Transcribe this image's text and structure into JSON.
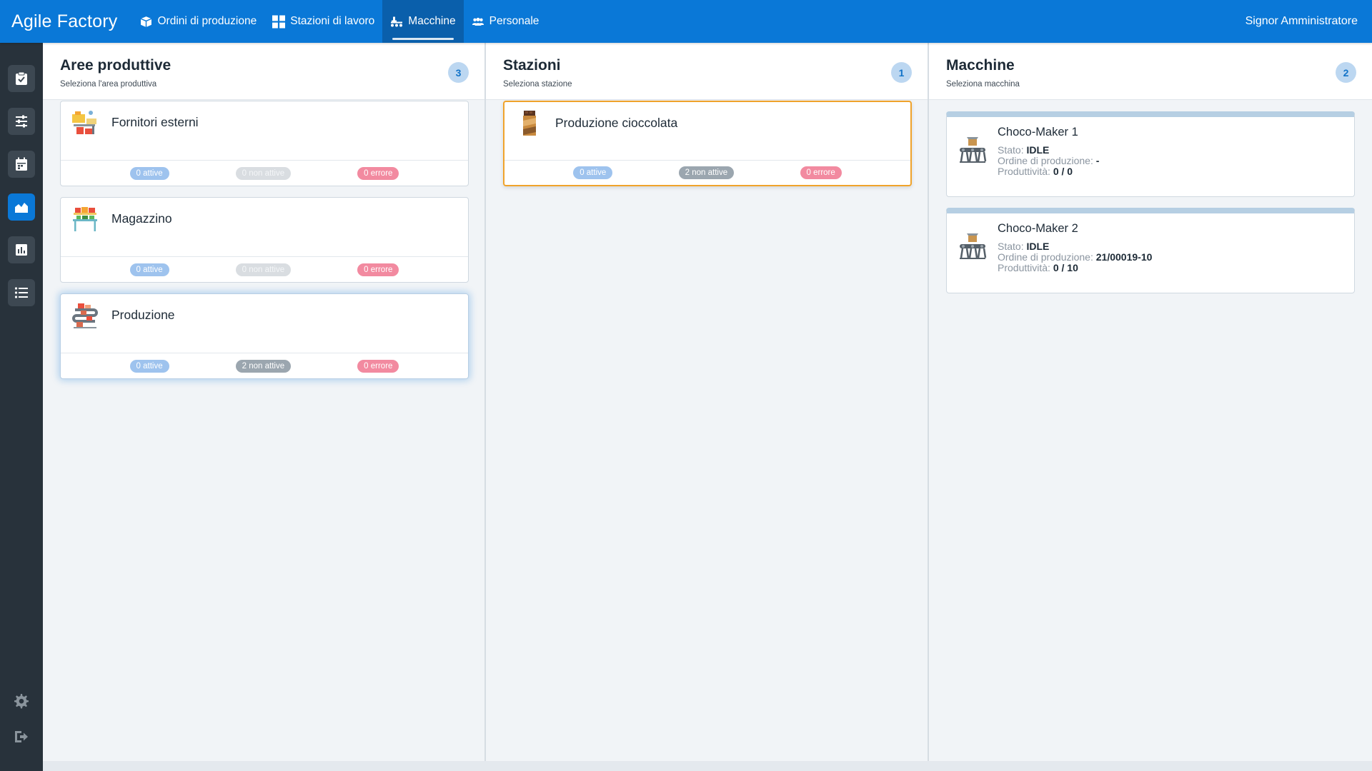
{
  "app": {
    "brand": "Agile Factory",
    "user": "Signor Amministratore"
  },
  "nav": [
    {
      "label": "Ordini di produzione",
      "icon": "box-icon"
    },
    {
      "label": "Stazioni di lavoro",
      "icon": "grid-icon"
    },
    {
      "label": "Macchine",
      "icon": "machine-icon",
      "active": true
    },
    {
      "label": "Personale",
      "icon": "people-icon"
    }
  ],
  "sidebar": {
    "items": [
      "clipboard-check-icon",
      "sliders-icon",
      "calendar-icon",
      "factory-chart-icon",
      "bar-chart-icon",
      "list-icon"
    ],
    "active_index": 3,
    "bottom": [
      "gear-icon",
      "logout-icon"
    ]
  },
  "columns": {
    "areas": {
      "title": "Aree produttive",
      "subtitle": "Seleziona l'area produttiva",
      "count": "3",
      "cards": [
        {
          "name": "Fornitori esterni",
          "active": "0 attive",
          "inactive": "0 non attive",
          "error": "0 errore"
        },
        {
          "name": "Magazzino",
          "active": "0 attive",
          "inactive": "0 non attive",
          "error": "0 errore"
        },
        {
          "name": "Produzione",
          "active": "0 attive",
          "inactive": "2 non attive",
          "error": "0 errore"
        }
      ]
    },
    "stations": {
      "title": "Stazioni",
      "subtitle": "Seleziona stazione",
      "count": "1",
      "cards": [
        {
          "name": "Produzione cioccolata",
          "active": "0 attive",
          "inactive": "2 non attive",
          "error": "0 errore"
        }
      ]
    },
    "machines": {
      "title": "Macchine",
      "subtitle": "Seleziona macchina",
      "count": "2",
      "labels": {
        "state": "Stato:",
        "order": "Ordine di produzione:",
        "productivity": "Produttività:"
      },
      "cards": [
        {
          "name": "Choco-Maker 1",
          "state": "IDLE",
          "order": "-",
          "productivity": "0 / 0"
        },
        {
          "name": "Choco-Maker 2",
          "state": "IDLE",
          "order": "21/00019-10",
          "productivity": "0 / 10"
        }
      ]
    }
  },
  "colors": {
    "primary": "#0a78d7",
    "primary_dark": "#0a5fab",
    "sidebar": "#28323b",
    "pill_active": "#9ec3ee",
    "pill_inactive": "#d9dde1",
    "pill_error": "#f28aa0",
    "selected_border": "#f0a32b"
  }
}
